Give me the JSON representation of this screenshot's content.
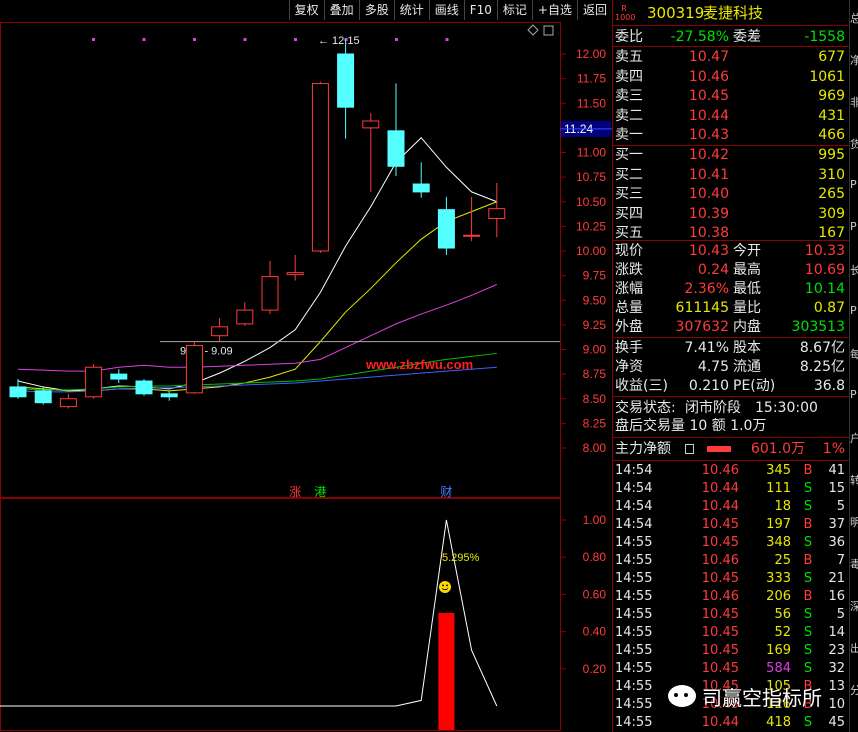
{
  "toolbar": [
    "复权",
    "叠加",
    "多股",
    "统计",
    "画线",
    "F10",
    "标记",
    "+自选",
    "返回"
  ],
  "stock": {
    "badge_top": "R",
    "badge_bottom": "1000",
    "code": "300319",
    "name": "麦捷科技"
  },
  "weibi": {
    "label": "委比",
    "value": "-27.58%",
    "label2": "委差",
    "value2": "-1558"
  },
  "asks": [
    {
      "label": "卖五",
      "price": "10.47",
      "vol": "677"
    },
    {
      "label": "卖四",
      "price": "10.46",
      "vol": "1061"
    },
    {
      "label": "卖三",
      "price": "10.45",
      "vol": "969"
    },
    {
      "label": "卖二",
      "price": "10.44",
      "vol": "431"
    },
    {
      "label": "卖一",
      "price": "10.43",
      "vol": "466"
    }
  ],
  "bids": [
    {
      "label": "买一",
      "price": "10.42",
      "vol": "995"
    },
    {
      "label": "买二",
      "price": "10.41",
      "vol": "310"
    },
    {
      "label": "买三",
      "price": "10.40",
      "vol": "265"
    },
    {
      "label": "买四",
      "price": "10.39",
      "vol": "309"
    },
    {
      "label": "买五",
      "price": "10.38",
      "vol": "167"
    }
  ],
  "stats": [
    {
      "l1": "现价",
      "v1": "10.43",
      "c1": "red",
      "l2": "今开",
      "v2": "10.33",
      "c2": "red"
    },
    {
      "l1": "涨跌",
      "v1": "0.24",
      "c1": "red",
      "l2": "最高",
      "v2": "10.69",
      "c2": "red"
    },
    {
      "l1": "涨幅",
      "v1": "2.36%",
      "c1": "red",
      "l2": "最低",
      "v2": "10.14",
      "c2": "green"
    },
    {
      "l1": "总量",
      "v1": "611145",
      "c1": "yellow",
      "l2": "量比",
      "v2": "0.87",
      "c2": "yellow"
    },
    {
      "l1": "外盘",
      "v1": "307632",
      "c1": "red",
      "l2": "内盘",
      "v2": "303513",
      "c2": "green"
    }
  ],
  "stats2": [
    {
      "l1": "换手",
      "v1": "7.41%",
      "l2": "股本",
      "v2": "8.67亿"
    },
    {
      "l1": "净资",
      "v1": "4.75",
      "l2": "流通",
      "v2": "8.25亿"
    },
    {
      "l1": "收益(三)",
      "v1": "0.210",
      "l2": "PE(动)",
      "v2": "36.8"
    }
  ],
  "trade_status": {
    "label": "交易状态:",
    "value": "闭市阶段",
    "time": "15:30:00"
  },
  "after_hours": {
    "text": "盘后交易量 10 额 1.0万"
  },
  "main_flow": {
    "label": "主力净额",
    "value": "601.0万",
    "pct": "1%"
  },
  "ticks": [
    {
      "t": "14:54",
      "p": "10.46",
      "v": "345",
      "bs": "B",
      "n": "41"
    },
    {
      "t": "14:54",
      "p": "10.44",
      "v": "111",
      "bs": "S",
      "n": "15"
    },
    {
      "t": "14:54",
      "p": "10.44",
      "v": "18",
      "bs": "S",
      "n": "5"
    },
    {
      "t": "14:54",
      "p": "10.45",
      "v": "197",
      "bs": "B",
      "n": "37"
    },
    {
      "t": "14:55",
      "p": "10.45",
      "v": "348",
      "bs": "S",
      "n": "36"
    },
    {
      "t": "14:55",
      "p": "10.46",
      "v": "25",
      "bs": "B",
      "n": "7"
    },
    {
      "t": "14:55",
      "p": "10.45",
      "v": "333",
      "bs": "S",
      "n": "21"
    },
    {
      "t": "14:55",
      "p": "10.46",
      "v": "206",
      "bs": "B",
      "n": "16"
    },
    {
      "t": "14:55",
      "p": "10.45",
      "v": "56",
      "bs": "S",
      "n": "5"
    },
    {
      "t": "14:55",
      "p": "10.45",
      "v": "52",
      "bs": "S",
      "n": "14"
    },
    {
      "t": "14:55",
      "p": "10.45",
      "v": "169",
      "bs": "S",
      "n": "23"
    },
    {
      "t": "14:55",
      "p": "10.45",
      "v": "584",
      "bs": "S",
      "n": "32"
    },
    {
      "t": "14:55",
      "p": "10.45",
      "v": "105",
      "bs": "B",
      "n": "13"
    },
    {
      "t": "14:55",
      "p": "10.45",
      "v": "126",
      "bs": "B",
      "n": "10"
    },
    {
      "t": "14:55",
      "p": "10.44",
      "v": "418",
      "bs": "S",
      "n": "45"
    }
  ],
  "edge_text": [
    "总",
    "净",
    "非",
    "货",
    "P",
    "P",
    "长",
    "P",
    "每",
    "P",
    "户",
    "转",
    "明",
    "毒",
    "深",
    "出",
    "分"
  ],
  "watermark": {
    "text": "司赢空指标所"
  },
  "chart_data": [
    {
      "type": "candlestick",
      "ylim": [
        7.9,
        12.4
      ],
      "y_ticks": [
        "12.00",
        "11.75",
        "11.50",
        "11.25",
        "11.00",
        "10.75",
        "10.50",
        "10.25",
        "10.00",
        "9.75",
        "9.50",
        "9.25",
        "9.00",
        "8.75",
        "8.50",
        "8.25",
        "8.00"
      ],
      "price_marker": "11.24",
      "max_label": "12.15",
      "min_label": "9.08 - 9.09",
      "website": "www.zbzfwu.com",
      "candles": [
        {
          "o": 8.52,
          "c": 8.62,
          "h": 8.7,
          "l": 8.5,
          "dir": "down"
        },
        {
          "o": 8.58,
          "c": 8.46,
          "h": 8.62,
          "l": 8.44,
          "dir": "down"
        },
        {
          "o": 8.42,
          "c": 8.5,
          "h": 8.55,
          "l": 8.4,
          "dir": "up"
        },
        {
          "o": 8.52,
          "c": 8.82,
          "h": 8.85,
          "l": 8.5,
          "dir": "up"
        },
        {
          "o": 8.75,
          "c": 8.7,
          "h": 8.8,
          "l": 8.66,
          "dir": "down"
        },
        {
          "o": 8.68,
          "c": 8.55,
          "h": 8.7,
          "l": 8.53,
          "dir": "down"
        },
        {
          "o": 8.55,
          "c": 8.52,
          "h": 8.58,
          "l": 8.48,
          "dir": "down"
        },
        {
          "o": 8.56,
          "c": 9.04,
          "h": 9.08,
          "l": 8.55,
          "dir": "up"
        },
        {
          "o": 9.14,
          "c": 9.23,
          "h": 9.32,
          "l": 9.08,
          "dir": "up"
        },
        {
          "o": 9.26,
          "c": 9.4,
          "h": 9.48,
          "l": 9.24,
          "dir": "up"
        },
        {
          "o": 9.4,
          "c": 9.74,
          "h": 9.9,
          "l": 9.36,
          "dir": "up"
        },
        {
          "o": 9.76,
          "c": 9.78,
          "h": 9.96,
          "l": 9.7,
          "dir": "up"
        },
        {
          "o": 10.0,
          "c": 11.7,
          "h": 11.72,
          "l": 9.98,
          "dir": "up"
        },
        {
          "o": 12.0,
          "c": 11.46,
          "h": 12.15,
          "l": 11.14,
          "dir": "down"
        },
        {
          "o": 11.25,
          "c": 11.32,
          "h": 11.4,
          "l": 10.6,
          "dir": "up"
        },
        {
          "o": 11.22,
          "c": 10.86,
          "h": 11.7,
          "l": 10.76,
          "dir": "down"
        },
        {
          "o": 10.68,
          "c": 10.6,
          "h": 10.9,
          "l": 10.54,
          "dir": "down"
        },
        {
          "o": 10.42,
          "c": 10.03,
          "h": 10.55,
          "l": 9.96,
          "dir": "down"
        },
        {
          "o": 10.15,
          "c": 10.16,
          "h": 10.55,
          "l": 10.1,
          "dir": "up"
        },
        {
          "o": 10.33,
          "c": 10.43,
          "h": 10.69,
          "l": 10.14,
          "dir": "up"
        }
      ],
      "ma": [
        {
          "color": "#ffffff",
          "values": [
            8.68,
            8.62,
            8.58,
            8.6,
            8.63,
            8.62,
            8.6,
            8.66,
            8.76,
            8.88,
            9.02,
            9.2,
            9.58,
            10.05,
            10.45,
            10.9,
            11.15,
            10.85,
            10.6,
            10.5
          ]
        },
        {
          "color": "#e8e800",
          "values": [
            8.62,
            8.6,
            8.58,
            8.58,
            8.6,
            8.6,
            8.58,
            8.6,
            8.62,
            8.66,
            8.72,
            8.8,
            9.08,
            9.38,
            9.62,
            9.88,
            10.12,
            10.3,
            10.4,
            10.5
          ]
        },
        {
          "color": "#e040e0",
          "values": [
            8.8,
            8.79,
            8.78,
            8.78,
            8.82,
            8.84,
            8.82,
            8.82,
            8.83,
            8.84,
            8.85,
            8.86,
            8.9,
            9.02,
            9.14,
            9.26,
            9.36,
            9.45,
            9.55,
            9.66
          ]
        },
        {
          "color": "#00c000",
          "values": [
            8.6,
            8.59,
            8.59,
            8.6,
            8.62,
            8.63,
            8.63,
            8.64,
            8.65,
            8.66,
            8.67,
            8.68,
            8.7,
            8.74,
            8.78,
            8.82,
            8.86,
            8.9,
            8.93,
            8.96
          ]
        },
        {
          "color": "#4060ff",
          "values": [
            8.58,
            8.57,
            8.57,
            8.58,
            8.6,
            8.61,
            8.61,
            8.62,
            8.63,
            8.64,
            8.65,
            8.66,
            8.68,
            8.7,
            8.72,
            8.74,
            8.76,
            8.78,
            8.8,
            8.82
          ]
        }
      ]
    },
    {
      "type": "line",
      "ylim": [
        0,
        1.1
      ],
      "y_ticks": [
        "1.00",
        "0.80",
        "0.60",
        "0.40",
        "0.20"
      ],
      "tags": [
        {
          "text": "涨",
          "color": "#ff3b3b",
          "index": 11
        },
        {
          "text": "港",
          "color": "#00e000",
          "index": 12
        },
        {
          "text": "财",
          "color": "#4080ff",
          "index": 17
        }
      ],
      "annotation": "5.295",
      "annotation_unit": "%",
      "line_values": [
        0,
        0,
        0,
        0,
        0,
        0,
        0,
        0,
        0,
        0,
        0,
        0,
        0,
        0,
        0,
        0,
        0.03,
        1.0,
        0.3,
        0
      ],
      "bar": {
        "index": 17,
        "value": 0.5
      }
    }
  ]
}
